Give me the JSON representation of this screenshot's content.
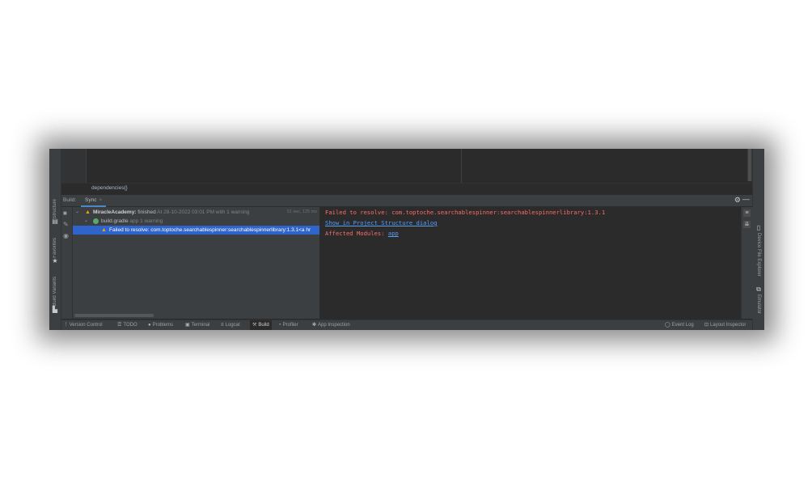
{
  "left_tabs": [
    {
      "label": "Structure",
      "icon": "structure-icon"
    },
    {
      "label": "Favorites",
      "icon": "star-icon"
    },
    {
      "label": "Build Variants",
      "icon": "build-variants-icon"
    }
  ],
  "right_tabs": [
    {
      "label": "Device File Explorer",
      "icon": "device-icon"
    },
    {
      "label": "Emulator",
      "icon": "emulator-icon"
    }
  ],
  "editor": {
    "breadcrumb": "dependencies{}"
  },
  "build_panel": {
    "label": "Build:",
    "tab": "Sync",
    "tree": [
      {
        "project": "MiracleAcademy:",
        "status": "finished",
        "detail": "At 28-10-2022 03:01 PM with 1 warning",
        "time": "51 sec, 125 ms"
      },
      {
        "name": "build.gradle",
        "detail": "app 1 warning"
      },
      {
        "text": "Failed to resolve: com.toptoche.searchablespinner:searchablespinnerlibrary:1.3.1<a hr"
      }
    ]
  },
  "output": {
    "error": "Failed to resolve: com.toptoche.searchablespinner:searchablespinnerlibrary:1.3.1",
    "link": "Show in Project Structure dialog",
    "affected_label": "Affected Modules:",
    "affected_module": "app"
  },
  "status_bar": {
    "left": [
      "Version Control",
      "TODO",
      "Problems",
      "Terminal",
      "Logcat",
      "Build",
      "Profiler",
      "App Inspection"
    ],
    "right": [
      "Event Log",
      "Layout Inspector"
    ]
  },
  "colors": {
    "error": "#ff6b68",
    "link": "#589df6",
    "selection": "#2f65ca",
    "warning": "#e5a50a"
  }
}
